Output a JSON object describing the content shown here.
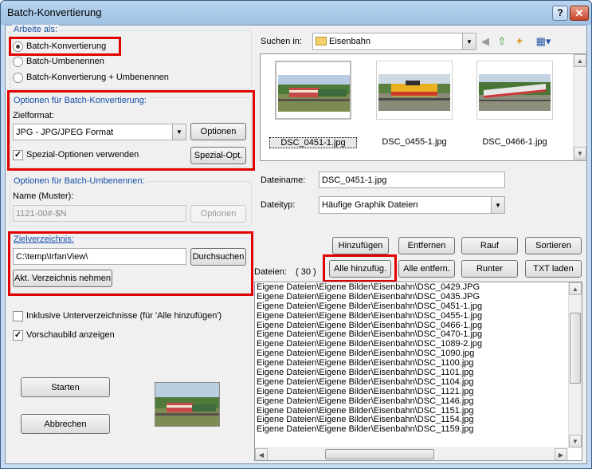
{
  "window": {
    "title": "Batch-Konvertierung",
    "help_label": "?",
    "close_label": "✕"
  },
  "work_mode": {
    "title": "Arbeite als:",
    "options": [
      "Batch-Konvertierung",
      "Batch-Umbenennen",
      "Batch-Konvertierung + Umbenennen"
    ],
    "selected_index": 0
  },
  "convert_options": {
    "title": "Optionen für Batch-Konvertierung:",
    "format_label": "Zielformat:",
    "format_value": "JPG - JPG/JPEG Format",
    "options_button": "Optionen",
    "special_label": "Spezial-Optionen verwenden",
    "special_checked": true,
    "special_button": "Spezial-Opt."
  },
  "rename_options": {
    "title": "Optionen für Batch-Umbenennen:",
    "pattern_label": "Name (Muster):",
    "pattern_value": "1121-00#-$N",
    "options_button": "Optionen"
  },
  "target_dir": {
    "title": "Zielverzeichnis:",
    "path": "C:\\temp\\IrfanView\\",
    "browse_button": "Durchsuchen",
    "current_button": "Akt. Verzeichnis nehmen"
  },
  "checkboxes": {
    "include_subdirs": {
      "label": "Inklusive Unterverzeichnisse (für 'Alle hinzufügen')",
      "checked": false
    },
    "show_preview": {
      "label": "Vorschaubild anzeigen",
      "checked": true
    }
  },
  "actions": {
    "start": "Starten",
    "cancel": "Abbrechen"
  },
  "browser": {
    "look_in_label": "Suchen in:",
    "look_in_value": "Eisenbahn",
    "thumbnails": [
      {
        "name": "DSC_0451-1.jpg",
        "selected": true
      },
      {
        "name": "DSC_0455-1.jpg",
        "selected": false
      },
      {
        "name": "DSC_0466-1.jpg",
        "selected": false
      }
    ],
    "filename_label": "Dateiname:",
    "filename_value": "DSC_0451-1.jpg",
    "filetype_label": "Dateityp:",
    "filetype_value": "Häufige Graphik Dateien"
  },
  "file_buttons": {
    "add": "Hinzufügen",
    "remove": "Entfernen",
    "up": "Rauf",
    "sort": "Sortieren",
    "add_all": "Alle hinzufüg.",
    "remove_all": "Alle entfern.",
    "down": "Runter",
    "load_txt": "TXT laden"
  },
  "files": {
    "label": "Dateien:",
    "count": "( 30 )",
    "items": [
      "Eigene Dateien\\Eigene Bilder\\Eisenbahn\\DSC_0429.JPG",
      "Eigene Dateien\\Eigene Bilder\\Eisenbahn\\DSC_0435.JPG",
      "Eigene Dateien\\Eigene Bilder\\Eisenbahn\\DSC_0451-1.jpg",
      "Eigene Dateien\\Eigene Bilder\\Eisenbahn\\DSC_0455-1.jpg",
      "Eigene Dateien\\Eigene Bilder\\Eisenbahn\\DSC_0466-1.jpg",
      "Eigene Dateien\\Eigene Bilder\\Eisenbahn\\DSC_0470-1.jpg",
      "Eigene Dateien\\Eigene Bilder\\Eisenbahn\\DSC_1089-2.jpg",
      "Eigene Dateien\\Eigene Bilder\\Eisenbahn\\DSC_1090.jpg",
      "Eigene Dateien\\Eigene Bilder\\Eisenbahn\\DSC_1100.jpg",
      "Eigene Dateien\\Eigene Bilder\\Eisenbahn\\DSC_1101.jpg",
      "Eigene Dateien\\Eigene Bilder\\Eisenbahn\\DSC_1104.jpg",
      "Eigene Dateien\\Eigene Bilder\\Eisenbahn\\DSC_1121.jpg",
      "Eigene Dateien\\Eigene Bilder\\Eisenbahn\\DSC_1146.jpg",
      "Eigene Dateien\\Eigene Bilder\\Eisenbahn\\DSC_1151.jpg",
      "Eigene Dateien\\Eigene Bilder\\Eisenbahn\\DSC_1154.jpg",
      "Eigene Dateien\\Eigene Bilder\\Eisenbahn\\DSC_1159.jpg"
    ]
  },
  "colors": {
    "highlight": "#e00000",
    "group_title": "#1550a8",
    "title_bar": "#b9d4ee"
  }
}
